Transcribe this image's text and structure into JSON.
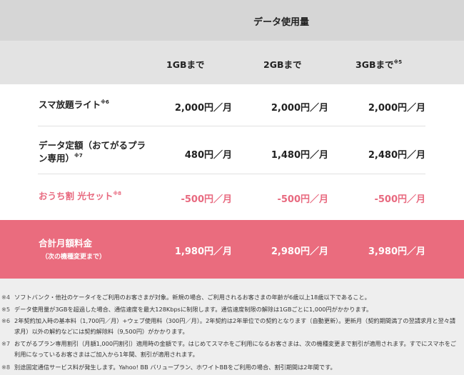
{
  "header": {
    "title": "データ使用量"
  },
  "columns": [
    {
      "label": "1GBまで",
      "note": ""
    },
    {
      "label": "2GBまで",
      "note": ""
    },
    {
      "label": "3GBまで",
      "note": "※5"
    }
  ],
  "rows": [
    {
      "label": "スマ放題ライト",
      "note": "※6",
      "values": [
        "2,000円／月",
        "2,000円／月",
        "2,000円／月"
      ]
    },
    {
      "label_line1": "データ定額（おてがるプラ",
      "label_line2": "ン専用）",
      "note": "※7",
      "values": [
        "480円／月",
        "1,480円／月",
        "2,480円／月"
      ]
    },
    {
      "label": "おうち割 光セット",
      "note": "※8",
      "values": [
        "-500円／月",
        "-500円／月",
        "-500円／月"
      ]
    }
  ],
  "total": {
    "label": "合計月額料金",
    "sublabel": "（次の機種変更まで）",
    "values": [
      "1,980円／月",
      "2,980円／月",
      "3,980円／月"
    ]
  },
  "colors": {
    "accent_pink": "#e8697f",
    "total_band": "#ea6c7e",
    "header_gray": "#d6d6d6"
  },
  "notes": [
    {
      "mark": "※4",
      "text": "ソフトバンク・他社のケータイをご利用のお客さまが対象。新規の場合、ご利用されるお客さまの年齢が6歳以上18歳以下であること。"
    },
    {
      "mark": "※5",
      "text": "データ使用量が3GBを超過した場合、通信速度を最大128Kbpsに制限します。通信速度制限の解除は1GBごとに1,000円がかかります。"
    },
    {
      "mark": "※6",
      "text": "2年契約加入時の基本料（1,700円／月）+ウェブ使用料（300円／月）。2年契約は2年単位での契約となります（自動更新）。更新月（契約期間満了の翌請求月と翌々請求月）以外の解約などには契約解除料（9,500円）がかかります。"
    },
    {
      "mark": "※7",
      "text": "おてがるプラン専用割引（月額1,000円割引）適用時の金額です。はじめてスマホをご利用になるお客さまは、次の機種変更まで割引が適用されます。すでにスマホをご利用になっているお客さまはご加入から1年間、割引が適用されます。"
    },
    {
      "mark": "※8",
      "text": "別途固定通信サービス料が発生します。Yahoo! BB バリュープラン、ホワイトBBをご利用の場合、割引期間は2年間です。"
    }
  ]
}
